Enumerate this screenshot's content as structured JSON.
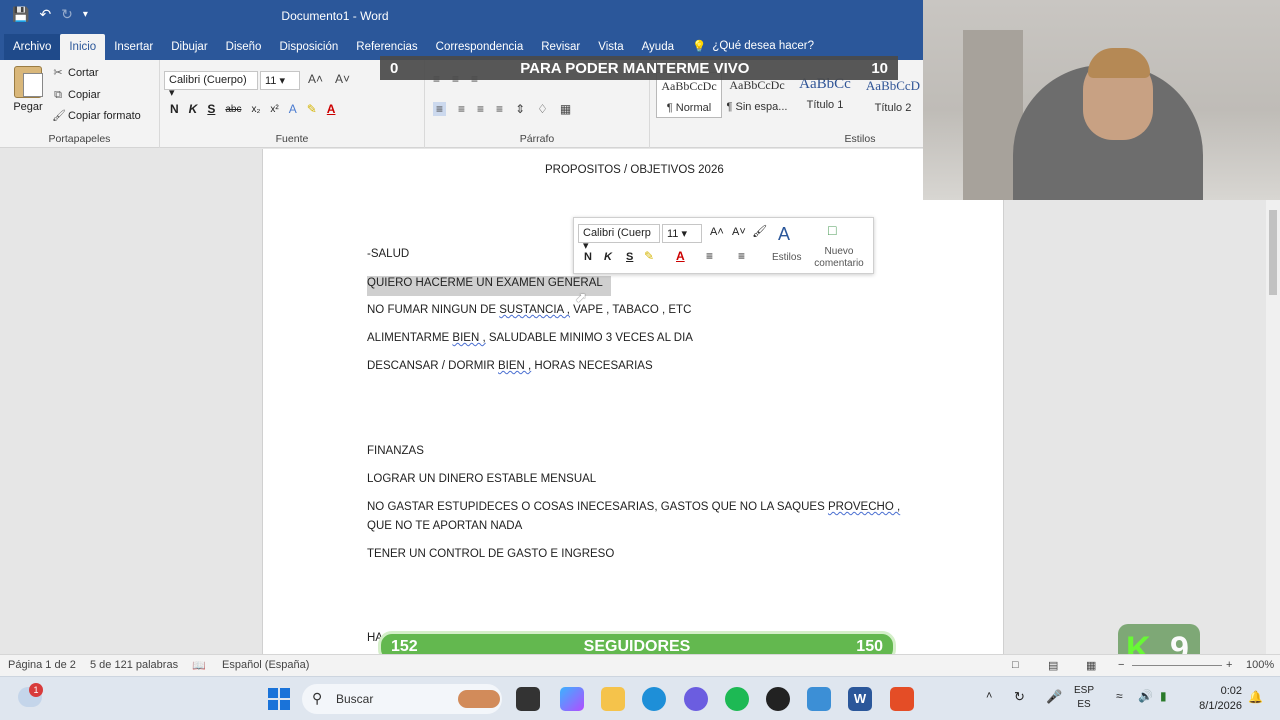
{
  "titlebar": {
    "title": "Documento1 - Word"
  },
  "tabs": [
    "Archivo",
    "Inicio",
    "Insertar",
    "Dibujar",
    "Diseño",
    "Disposición",
    "Referencias",
    "Correspondencia",
    "Revisar",
    "Vista",
    "Ayuda"
  ],
  "tell_me": "¿Qué desea hacer?",
  "clipboard": {
    "paste": "Pegar",
    "cut": "Cortar",
    "copy": "Copiar",
    "format_painter": "Copiar formato",
    "label": "Portapapeles"
  },
  "font": {
    "name": "Calibri (Cuerpo)",
    "size": "11",
    "label": "Fuente"
  },
  "paragraph": {
    "label": "Párrafo"
  },
  "styles": {
    "label": "Estilos",
    "items": [
      {
        "preview": "AaBbCcDc",
        "name": "¶ Normal"
      },
      {
        "preview": "AaBbCcDc",
        "name": "¶ Sin espa..."
      },
      {
        "preview": "AaBbCc",
        "name": "Título 1"
      },
      {
        "preview": "AaBbCcD",
        "name": "Título 2"
      }
    ]
  },
  "overlay_top": {
    "left": "0",
    "text": "PARA PODER MANTERME VIVO",
    "right": "10"
  },
  "overlay_bottom": {
    "left": "152",
    "text": "SEGUIDORES",
    "right": "150"
  },
  "kbadge": "9",
  "document": {
    "title": "PROPOSITOS / OBJETIVOS 2026",
    "salud": "-SALUD",
    "s1": "QUIERO HACERME UN EXAMEN GENERAL",
    "s2a": "NO FUMAR NINGUN DE ",
    "s2b": "SUSTANCIA ,",
    "s2c": " VAPE , TABACO , ETC",
    "s3a": "ALIMENTARME ",
    "s3b": "BIEN ,",
    "s3c": " SALUDABLE  MINIMO 3 VECES AL DIA",
    "s4a": "DESCANSAR / DORMIR ",
    "s4b": "BIEN ,",
    "s4c": " HORAS NECESARIAS",
    "finanzas": "FINANZAS",
    "f1": "LOGRAR UN DINERO ESTABLE MENSUAL",
    "f2a": "NO GASTAR ESTUPIDECES O COSAS INECESARIAS, GASTOS QUE NO LA SAQUES ",
    "f2b": "PROVECHO ,",
    "f2c": "QUE NO TE APORTAN NADA",
    "f3": "TENER UN CONTROL DE GASTO E INGRESO",
    "partial": "HA"
  },
  "mini_toolbar": {
    "font": "Calibri (Cuerp",
    "size": "11",
    "styles": "Estilos",
    "comment1": "Nuevo",
    "comment2": "comentario"
  },
  "statusbar": {
    "page": "Página 1 de 2",
    "words": "5 de 121 palabras",
    "language": "Español (España)",
    "zoom": "100%"
  },
  "taskbar": {
    "search": "Buscar",
    "lang1": "ESP",
    "lang2": "ES",
    "time": "0:02",
    "date": "8/1/2026",
    "badge": "1"
  },
  "colors": {
    "word_blue": "#2b579a",
    "overlay_green": "#63b84f"
  }
}
